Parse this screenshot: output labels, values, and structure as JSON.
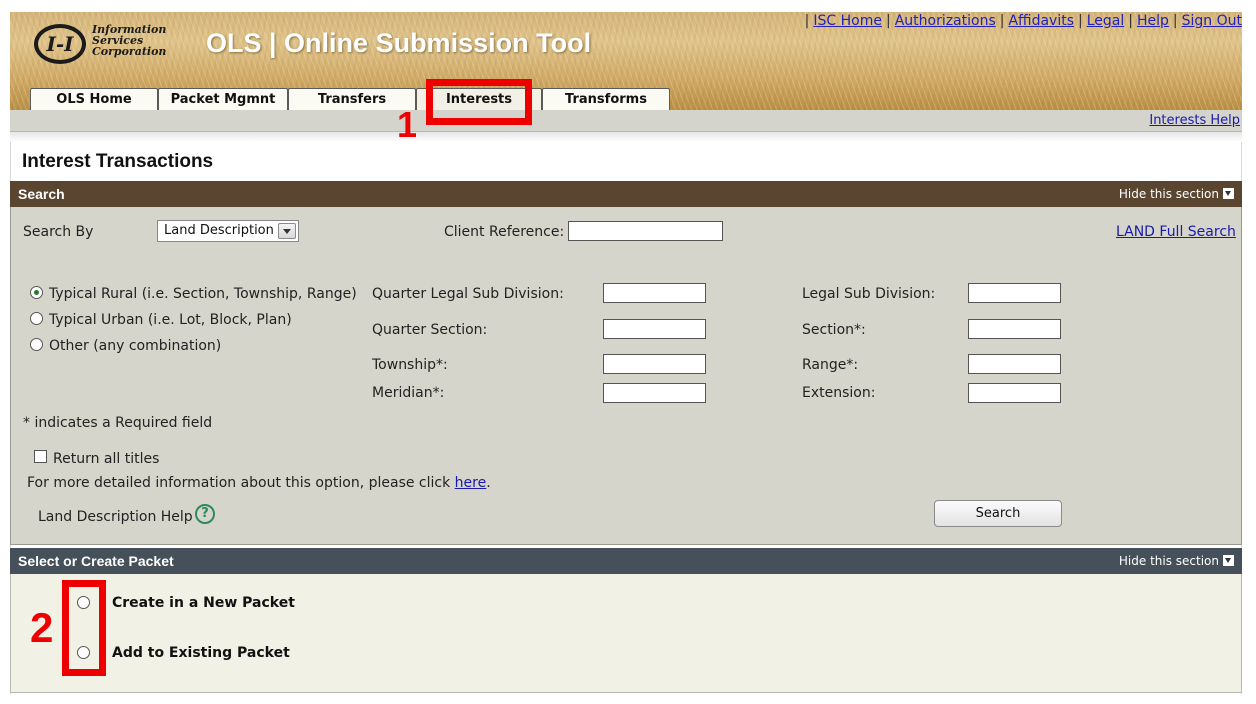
{
  "header": {
    "logo_mark": "I-I",
    "logo_lines": [
      "Information",
      "Services",
      "Corporation"
    ],
    "app_title": "OLS | Online Submission Tool",
    "top_links": [
      "ISC Home",
      "Authorizations",
      "Affidavits",
      "Legal",
      "Help",
      "Sign Out"
    ],
    "separator": "|"
  },
  "tabs": [
    {
      "label": "OLS Home",
      "active": false
    },
    {
      "label": "Packet Mgmnt",
      "active": false
    },
    {
      "label": "Transfers",
      "active": false
    },
    {
      "label": "Interests",
      "active": true
    },
    {
      "label": "Transforms",
      "active": false
    }
  ],
  "subbar": {
    "help_link": "Interests Help"
  },
  "page": {
    "title": "Interest Transactions"
  },
  "search_section": {
    "title": "Search",
    "hide_label": "Hide this section",
    "search_by_label": "Search By",
    "search_by_value": "Land Description",
    "client_ref_label": "Client Reference:",
    "client_ref_value": "",
    "land_full_search": "LAND Full Search",
    "radio_options": [
      {
        "label": "Typical Rural (i.e. Section, Township, Range)",
        "checked": true
      },
      {
        "label": "Typical Urban (i.e. Lot, Block, Plan)",
        "checked": false
      },
      {
        "label": "Other (any combination)",
        "checked": false
      }
    ],
    "fields_left": [
      {
        "label": "Quarter Legal Sub Division:",
        "value": ""
      },
      {
        "label": "Quarter Section:",
        "value": ""
      },
      {
        "label": "Township*:",
        "value": ""
      },
      {
        "label": "Meridian*:",
        "value": ""
      }
    ],
    "fields_right": [
      {
        "label": "Legal Sub Division:",
        "value": ""
      },
      {
        "label": "Section*:",
        "value": ""
      },
      {
        "label": "Range*:",
        "value": ""
      },
      {
        "label": "Extension:",
        "value": ""
      }
    ],
    "required_note": "* indicates a Required field",
    "return_all_titles": "Return all titles",
    "more_info_text": "For more detailed information about this option, please click",
    "more_info_link": "here",
    "more_info_end": ".",
    "land_help_label": "Land Description Help",
    "help_icon_glyph": "?",
    "search_button": "Search"
  },
  "packet_section": {
    "title": "Select or Create Packet",
    "hide_label": "Hide this section",
    "options": [
      {
        "label": "Create in a New Packet",
        "checked": false
      },
      {
        "label": "Add to Existing Packet",
        "checked": false
      }
    ]
  },
  "annotations": {
    "marker_1": "1",
    "marker_2": "2",
    "color": "#ee0000"
  },
  "colors": {
    "search_header": "#5a4630",
    "packet_header": "#46505a",
    "search_body": "#d6d5cc",
    "packet_body": "#f2f1e6",
    "link": "#1a1aaa"
  }
}
